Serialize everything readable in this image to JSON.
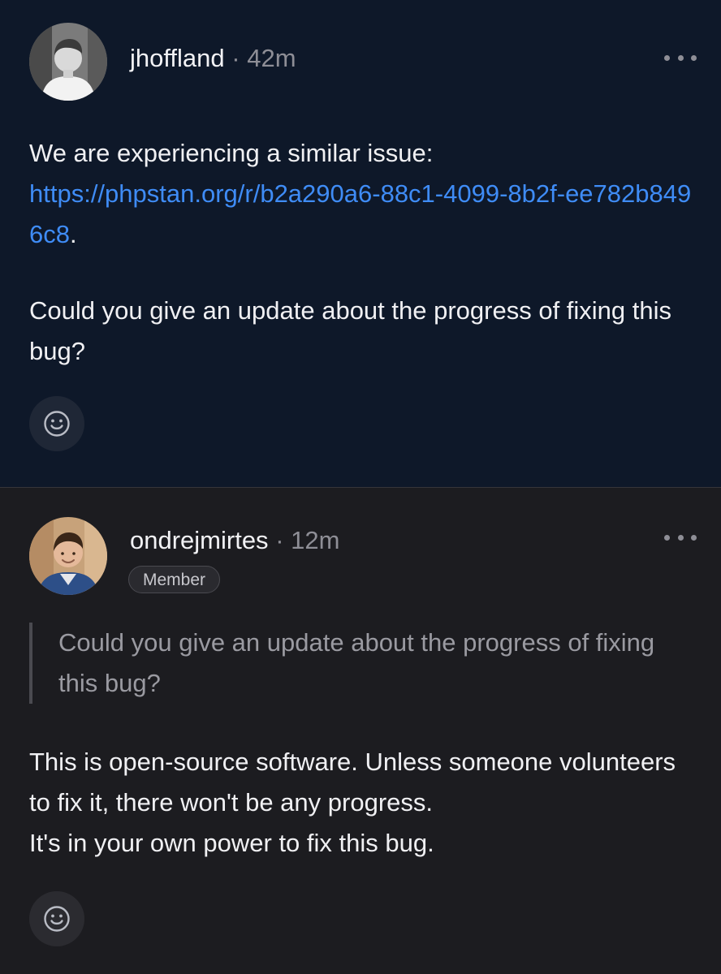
{
  "comments": [
    {
      "username": "jhoffland",
      "separator": "·",
      "time": "42m",
      "body": {
        "intro": "We are experiencing a similar issue:",
        "link": "https://phpstan.org/r/b2a290a6-88c1-4099-8b2f-ee782b8496c8",
        "link_suffix": ".",
        "question": "Could you give an update about the progress of fixing this bug?"
      },
      "icons": {
        "more": "more-horizontal-icon",
        "reaction": "smiley-icon"
      }
    },
    {
      "username": "ondrejmirtes",
      "separator": "·",
      "time": "12m",
      "badge": "Member",
      "quote": "Could you give an update about the progress of fixing this bug?",
      "body": {
        "line1": "This is open-source software. Unless someone volunteers to fix it, there won't be any progress.",
        "line2": "It's in your own power to fix this bug."
      },
      "icons": {
        "more": "more-horizontal-icon",
        "reaction": "smiley-icon"
      }
    }
  ],
  "colors": {
    "background_highlight": "#0e1829",
    "background": "#1c1c20",
    "link": "#3f8cf6",
    "muted": "#8e8e96"
  }
}
